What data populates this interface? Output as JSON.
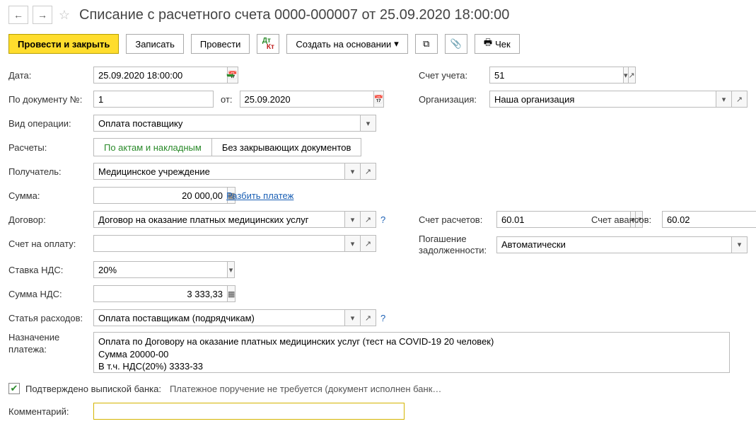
{
  "header": {
    "title": "Списание с расчетного счета 0000-000007 от 25.09.2020 18:00:00"
  },
  "toolbar": {
    "post_close": "Провести и закрыть",
    "save": "Записать",
    "post": "Провести",
    "create_based": "Создать на основании",
    "receipt": "Чек"
  },
  "labels": {
    "date": "Дата:",
    "doc_no": "По документу №:",
    "from": "от:",
    "op_type": "Вид операции:",
    "settlements": "Расчеты:",
    "by_acts": "По актам и накладным",
    "no_closing": "Без закрывающих документов",
    "payee": "Получатель:",
    "amount": "Сумма:",
    "split": "Разбить платеж",
    "contract": "Договор:",
    "invoice": "Счет на оплату:",
    "vat_rate": "Ставка НДС:",
    "vat_sum": "Сумма НДС:",
    "expense": "Статья расходов:",
    "purpose": "Назначение платежа:",
    "account": "Счет учета:",
    "org": "Организация:",
    "settle_acc": "Счет расчетов:",
    "advance_acc": "Счет авансов:",
    "debt": "Погашение задолженности:",
    "confirmed": "Подтверждено выпиской банка:",
    "confirmed_note": "Платежное поручение не требуется (документ исполнен банк…",
    "comment": "Комментарий:"
  },
  "values": {
    "date": "25.09.2020 18:00:00",
    "doc_no": "1",
    "doc_date": "25.09.2020",
    "op_type": "Оплата поставщику",
    "payee": "Медицинское учреждение",
    "amount": "20 000,00",
    "contract": "Договор на оказание платных медицинских услуг",
    "vat_rate": "20%",
    "vat_sum": "3 333,33",
    "expense": "Оплата поставщикам (подрядчикам)",
    "purpose": "Оплата по Договору на оказание платных медицинских услуг (тест на COVID-19 20 человек)\nСумма 20000-00\nВ т.ч. НДС(20%) 3333-33",
    "account": "51",
    "org": "Наша организация",
    "settle_acc": "60.01",
    "advance_acc": "60.02",
    "debt": "Автоматически",
    "comment": ""
  }
}
